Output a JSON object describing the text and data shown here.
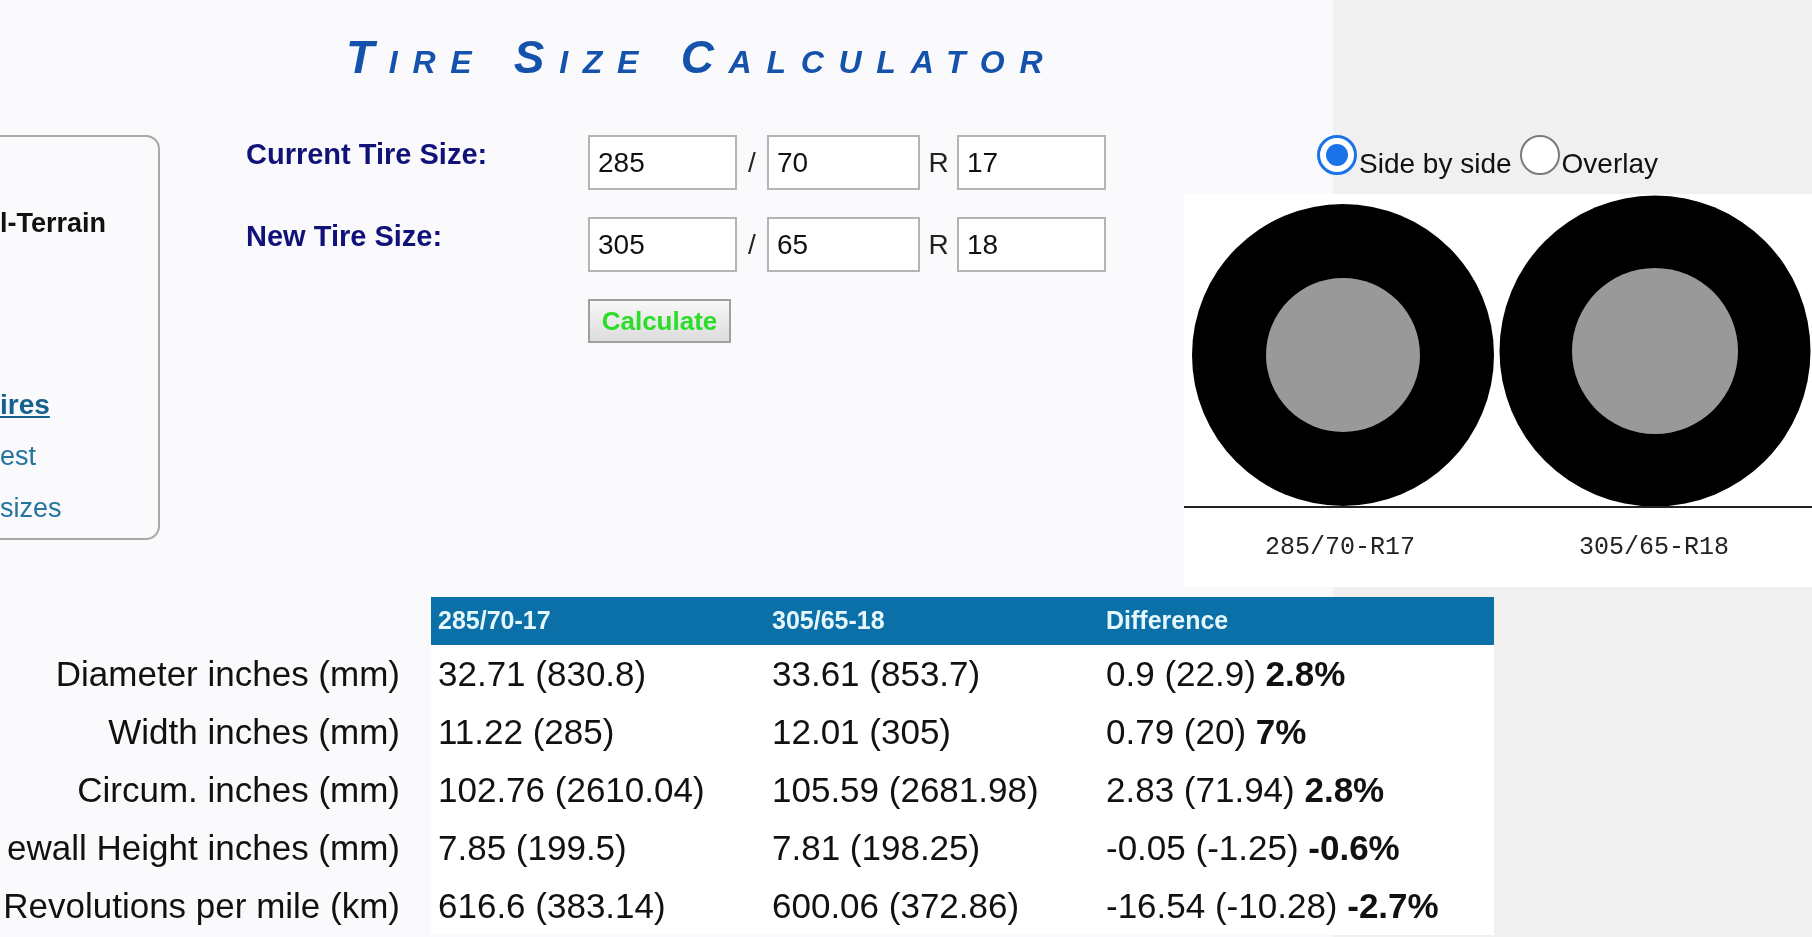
{
  "page_title": "Tire Size Calculator",
  "side_panel": {
    "items": [
      {
        "kind": "heading",
        "text": "l-Terrain"
      },
      {
        "kind": "link_heading",
        "text": "ires"
      },
      {
        "kind": "link",
        "text": "est"
      },
      {
        "kind": "link",
        "text": "sizes"
      }
    ]
  },
  "form": {
    "rows": [
      {
        "label": "Current Tire Size:",
        "values": [
          "285",
          "70",
          "17"
        ],
        "separators": [
          "/",
          "R"
        ]
      },
      {
        "label": "New Tire Size:",
        "values": [
          "305",
          "65",
          "18"
        ],
        "separators": [
          "/",
          "R"
        ]
      }
    ],
    "button": "Calculate"
  },
  "view_options": [
    {
      "label": "Side by side",
      "selected": true
    },
    {
      "label": "Overlay",
      "selected": false
    }
  ],
  "diagram": {
    "labels": [
      "285/70-R17",
      "305/65-R18"
    ]
  },
  "results_table": {
    "columns": [
      "285/70-17",
      "305/65-18",
      "Difference"
    ],
    "rows": [
      {
        "label": "Diameter inches (mm)",
        "cells": [
          "32.71 (830.8)",
          "33.61 (853.7)",
          "0.9 (22.9) **2.8%**"
        ]
      },
      {
        "label": "Width inches (mm)",
        "cells": [
          "11.22 (285)",
          "12.01 (305)",
          "0.79 (20) **7%**"
        ]
      },
      {
        "label": "Circum. inches (mm)",
        "cells": [
          "102.76 (2610.04)",
          "105.59 (2681.98)",
          "2.83 (71.94) **2.8%**"
        ]
      },
      {
        "label": "ewall Height inches (mm)",
        "cells": [
          "7.85 (199.5)",
          "7.81 (198.25)",
          "-0.05 (-1.25) **-0.6%**"
        ]
      },
      {
        "label": "Revolutions per mile (km)",
        "cells": [
          "616.6 (383.14)",
          "600.06 (372.86)",
          "-16.54 (-10.28) **-2.7%**"
        ]
      }
    ]
  }
}
